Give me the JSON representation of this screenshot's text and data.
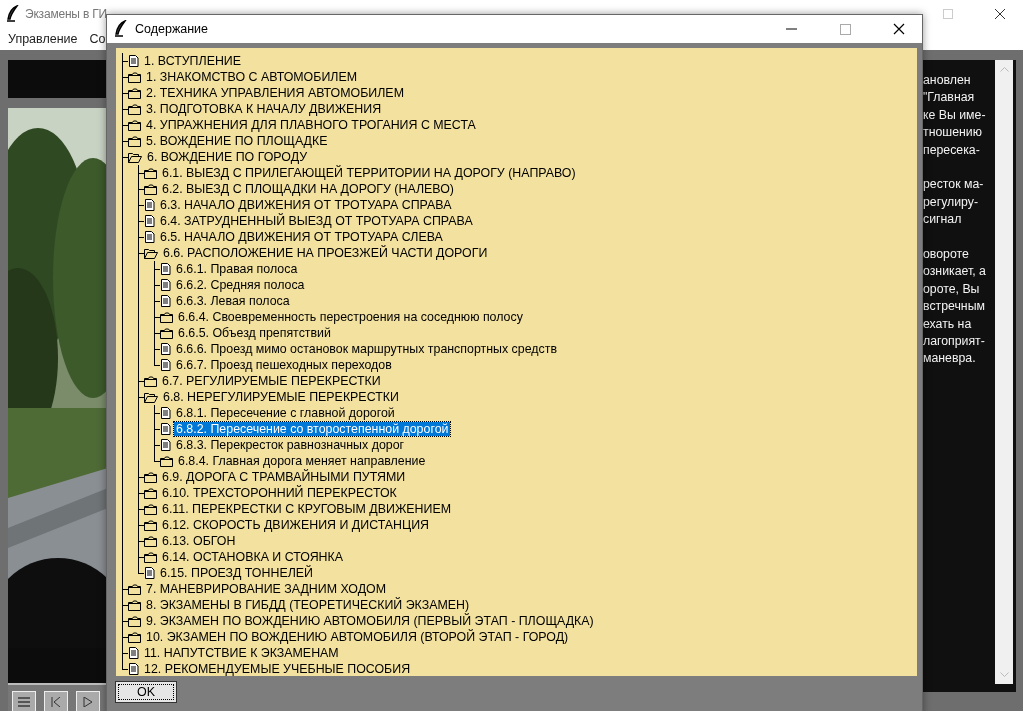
{
  "app": {
    "title": "Экзамены в ГИ",
    "menu": [
      "Управление",
      "Со"
    ],
    "text_paragraphs": [
      [
        "ановлен",
        "\"Главная",
        "ке Вы име-",
        "тношению",
        "пересека-"
      ],
      [
        "ресток ма-",
        "регулиру-",
        "сигнал"
      ],
      [
        "овороте",
        "озникает, а",
        "ороте, Вы",
        "встречным",
        "ехать на",
        "лагоприят-",
        "маневра."
      ]
    ]
  },
  "dialog": {
    "title": "Содержание",
    "ok_button": "OK",
    "tree": [
      {
        "label": "1. ВСТУПЛЕНИЕ",
        "kind": "document",
        "selected": false
      },
      {
        "label": "1. ЗНАКОМСТВО С АВТОМОБИЛЕМ",
        "kind": "folder",
        "expanded": false,
        "selected": false
      },
      {
        "label": "2. ТЕХНИКА УПРАВЛЕНИЯ АВТОМОБИЛЕМ",
        "kind": "folder",
        "expanded": false,
        "selected": false
      },
      {
        "label": "3. ПОДГОТОВКА К НАЧАЛУ ДВИЖЕНИЯ",
        "kind": "folder",
        "expanded": false,
        "selected": false
      },
      {
        "label": "4. УПРАЖНЕНИЯ ДЛЯ ПЛАВНОГО ТРОГАНИЯ С МЕСТА",
        "kind": "folder",
        "expanded": false,
        "selected": false
      },
      {
        "label": "5. ВОЖДЕНИЕ ПО ПЛОЩАДКЕ",
        "kind": "folder",
        "expanded": false,
        "selected": false
      },
      {
        "label": "6. ВОЖДЕНИЕ ПО ГОРОДУ",
        "kind": "folder",
        "expanded": true,
        "selected": false,
        "children": [
          {
            "label": "6.1. ВЫЕЗД С ПРИЛЕГАЮЩЕЙ ТЕРРИТОРИИ НА ДОРОГУ (НАПРАВО)",
            "kind": "folder",
            "expanded": false,
            "selected": false
          },
          {
            "label": "6.2. ВЫЕЗД С ПЛОЩАДКИ НА ДОРОГУ (НАЛЕВО)",
            "kind": "folder",
            "expanded": false,
            "selected": false
          },
          {
            "label": "6.3. НАЧАЛО ДВИЖЕНИЯ ОТ ТРОТУАРА СПРАВА",
            "kind": "document",
            "selected": false
          },
          {
            "label": "6.4. ЗАТРУДНЕННЫЙ ВЫЕЗД ОТ ТРОТУАРА СПРАВА",
            "kind": "document",
            "selected": false
          },
          {
            "label": "6.5. НАЧАЛО ДВИЖЕНИЯ ОТ ТРОТУАРА СЛЕВА",
            "kind": "document",
            "selected": false
          },
          {
            "label": "6.6. РАСПОЛОЖЕНИЕ НА ПРОЕЗЖЕЙ ЧАСТИ ДОРОГИ",
            "kind": "folder",
            "expanded": true,
            "selected": false,
            "children": [
              {
                "label": "6.6.1. Правая полоса",
                "kind": "document",
                "selected": false
              },
              {
                "label": "6.6.2. Средняя полоса",
                "kind": "document",
                "selected": false
              },
              {
                "label": "6.6.3. Левая полоса",
                "kind": "document",
                "selected": false
              },
              {
                "label": "6.6.4. Своевременность перестроения на соседнюю полосу",
                "kind": "folder",
                "expanded": false,
                "selected": false
              },
              {
                "label": "6.6.5. Объезд препятствий",
                "kind": "folder",
                "expanded": false,
                "selected": false
              },
              {
                "label": "6.6.6. Проезд мимо остановок маршрутных транспортных средств",
                "kind": "document",
                "selected": false
              },
              {
                "label": "6.6.7. Проезд пешеходных переходов",
                "kind": "document",
                "selected": false
              }
            ]
          },
          {
            "label": "6.7. РЕГУЛИРУЕМЫЕ ПЕРЕКРЕСТКИ",
            "kind": "folder",
            "expanded": false,
            "selected": false
          },
          {
            "label": "6.8. НЕРЕГУЛИРУЕМЫЕ ПЕРЕКРЕСТКИ",
            "kind": "folder",
            "expanded": true,
            "selected": false,
            "children": [
              {
                "label": "6.8.1. Пересечение с главной дорогой",
                "kind": "document",
                "selected": false
              },
              {
                "label": "6.8.2. Пересечение со второстепенной дорогой",
                "kind": "document",
                "selected": true
              },
              {
                "label": "6.8.3. Перекресток равнозначных дорог",
                "kind": "document",
                "selected": false
              },
              {
                "label": "6.8.4. Главная дорога меняет направление",
                "kind": "folder",
                "expanded": false,
                "selected": false
              }
            ]
          },
          {
            "label": "6.9. ДОРОГА С ТРАМВАЙНЫМИ ПУТЯМИ",
            "kind": "folder",
            "expanded": false,
            "selected": false
          },
          {
            "label": "6.10. ТРЕХСТОРОННИЙ ПЕРЕКРЕСТОК",
            "kind": "folder",
            "expanded": false,
            "selected": false
          },
          {
            "label": "6.11. ПЕРЕКРЕСТКИ С КРУГОВЫМ ДВИЖЕНИЕМ",
            "kind": "folder",
            "expanded": false,
            "selected": false
          },
          {
            "label": "6.12. СКОРОСТЬ ДВИЖЕНИЯ И ДИСТАНЦИЯ",
            "kind": "folder",
            "expanded": false,
            "selected": false
          },
          {
            "label": "6.13. ОБГОН",
            "kind": "folder",
            "expanded": false,
            "selected": false
          },
          {
            "label": "6.14. ОСТАНОВКА И СТОЯНКА",
            "kind": "folder",
            "expanded": false,
            "selected": false
          },
          {
            "label": "6.15. ПРОЕЗД ТОННЕЛЕЙ",
            "kind": "document",
            "selected": false
          }
        ]
      },
      {
        "label": "7. МАНЕВРИРОВАНИЕ ЗАДНИМ ХОДОМ",
        "kind": "folder",
        "expanded": false,
        "selected": false
      },
      {
        "label": "8. ЭКЗАМЕНЫ В ГИБДД (ТЕОРЕТИЧЕСКИЙ ЭКЗАМЕН)",
        "kind": "folder",
        "expanded": false,
        "selected": false
      },
      {
        "label": "9. ЭКЗАМЕН ПО ВОЖДЕНИЮ АВТОМОБИЛЯ (ПЕРВЫЙ ЭТАП - ПЛОЩАДКА)",
        "kind": "folder",
        "expanded": false,
        "selected": false
      },
      {
        "label": "10. ЭКЗАМЕН ПО ВОЖДЕНИЮ АВТОМОБИЛЯ (ВТОРОЙ ЭТАП - ГОРОД)",
        "kind": "folder",
        "expanded": false,
        "selected": false
      },
      {
        "label": "11. НАПУТСТВИЕ К ЭКЗАМЕНАМ",
        "kind": "document",
        "selected": false
      },
      {
        "label": "12. РЕКОМЕНДУЕМЫЕ УЧЕБНЫЕ ПОСОБИЯ",
        "kind": "document",
        "selected": false
      }
    ]
  }
}
